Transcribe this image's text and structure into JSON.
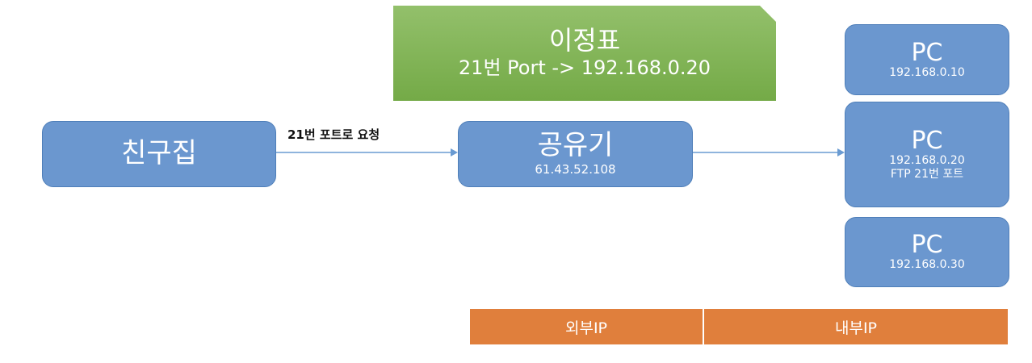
{
  "routing_table": {
    "title": "이정표",
    "rule": "21번 Port -> 192.168.0.20"
  },
  "friend_house": {
    "label": "친구집"
  },
  "edge": {
    "label": "21번 포트로 요청"
  },
  "router": {
    "label": "공유기",
    "ip": "61.43.52.108"
  },
  "pcs": [
    {
      "label": "PC",
      "ip": "192.168.0.10",
      "note": ""
    },
    {
      "label": "PC",
      "ip": "192.168.0.20",
      "note": "FTP 21번 포트"
    },
    {
      "label": "PC",
      "ip": "192.168.0.30",
      "note": ""
    }
  ],
  "zones": {
    "external": "외부IP",
    "internal": "내부IP"
  },
  "colors": {
    "node_fill": "#6b97cf",
    "table_fill": "#7fb354",
    "zone_fill": "#e07f3c",
    "arrow": "#6a9bd2"
  }
}
